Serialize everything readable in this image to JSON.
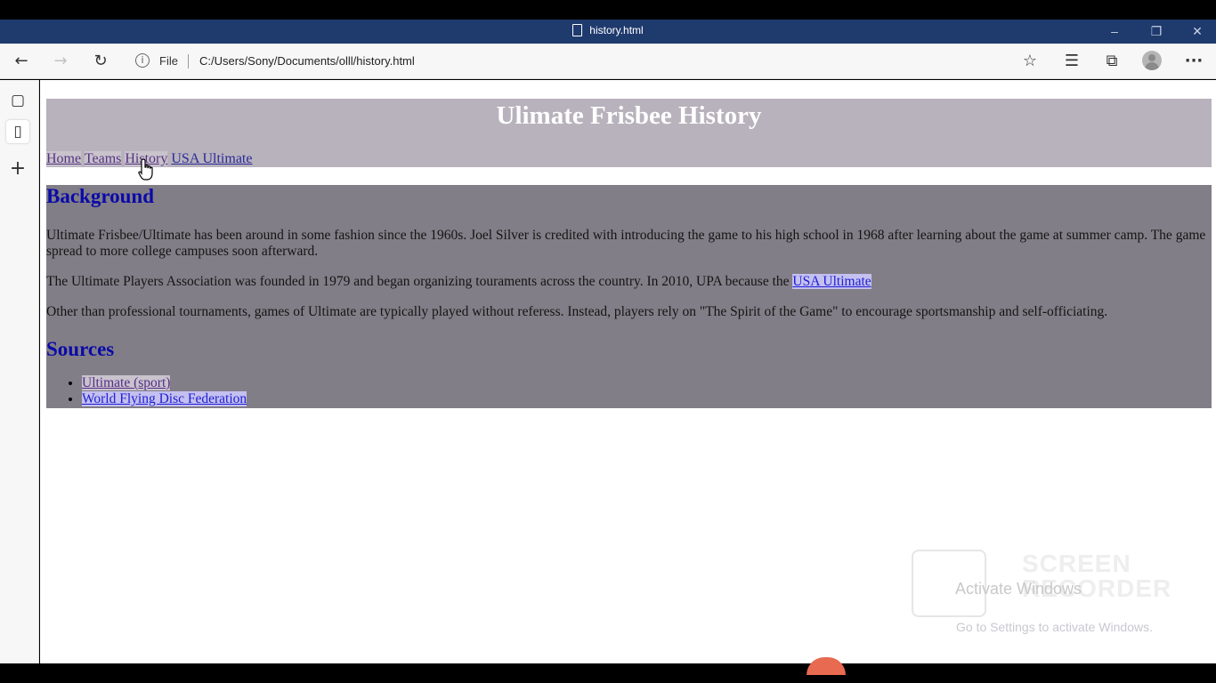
{
  "window": {
    "title": "history.html",
    "controls": {
      "minimize": "–",
      "restore": "❐",
      "close": "✕"
    }
  },
  "toolbar": {
    "back_icon": "←",
    "forward_icon": "→",
    "refresh_icon": "↻",
    "info_icon": "i",
    "file_label": "File",
    "url": "C:/Users/Sony/Documents/olll/history.html",
    "fav_add_icon": "☆",
    "favorites_icon": "☰",
    "collections_icon": "⧉",
    "more_icon": "···"
  },
  "sidebar": {
    "tabs_icon": "▢",
    "page_icon": "▯",
    "add_icon": "+"
  },
  "page": {
    "heading": "Ulimate Frisbee History",
    "nav": [
      {
        "label": "Home",
        "visited": true
      },
      {
        "label": "Teams",
        "visited": true
      },
      {
        "label": "History",
        "visited": true
      },
      {
        "label": "USA Ultimate",
        "visited": false
      }
    ],
    "background_heading": "Background",
    "paragraphs": [
      "Ultimate Frisbee/Ultimate has been around in some fashion since the 1960s. Joel Silver is credited with introducing the game to his high school in 1968 after learning about the game at summer camp. The game spread to more college campuses soon afterward.",
      "The Ultimate Players Association was founded in 1979 and began organizing touraments across the country. In 2010, UPA because the ",
      "Other than professional tournaments, games of Ultimate are typically played without referess. Instead, players rely on \"The Spirit of the Game\" to encourage sportsmanship and self-officiating."
    ],
    "inline_link": "USA Ultimate",
    "sources_heading": "Sources",
    "sources": [
      {
        "label": "Ultimate (sport)",
        "visited": true
      },
      {
        "label": "World Flying Disc Federation",
        "visited": false
      }
    ]
  },
  "overlay": {
    "activate_title": "Activate Windows",
    "activate_sub": "Go to Settings to activate Windows.",
    "recorder_text_1": "SCREEN",
    "recorder_text_2": "RECORDER"
  },
  "colors": {
    "titlebar": "#1f3a6d",
    "header_bg": "#b8b2bc",
    "main_bg": "#827e87",
    "heading_blue": "#0a0aa8"
  }
}
